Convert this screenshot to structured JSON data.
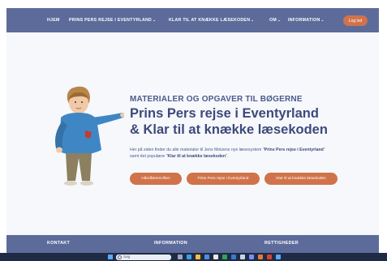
{
  "nav": {
    "items": [
      {
        "label": "HJEM",
        "dropdown": false
      },
      {
        "label": "PRINS PERS REJSE I EVENTYRLAND",
        "dropdown": true
      },
      {
        "label": "KLAR TIL AT KNÆKKE LÆSEKODEN",
        "dropdown": true
      },
      {
        "label": "OM",
        "dropdown": true
      },
      {
        "label": "INFORMATION",
        "dropdown": true
      }
    ],
    "login_label": "Log ind"
  },
  "hero": {
    "kicker": "MATERIALER OG OPGAVER TIL BØGERNE",
    "title_line1": "Prins Pers rejse i Eventyrland",
    "title_line2": "& Klar til at knække læsekoden",
    "intro_part1": "Her på siden finder du alle materialer til Jens Molzens nye læsesystem \"",
    "intro_bold1": "Prins Pers rejse i Eventyrland",
    "intro_part2": "\" samt det populære \"",
    "intro_bold2": "Klar til at knække læsekoden",
    "intro_part3": "\".",
    "buttons": [
      "Håndfærenviften",
      "Prins Pers rejse i Eventyrland",
      "Klar til at knække læsekoden"
    ]
  },
  "footer": {
    "headings": [
      "KONTAKT",
      "INFORMATION",
      "RETTIGHEDER"
    ]
  },
  "taskbar": {
    "search_placeholder": "Søg"
  },
  "colors": {
    "nav_bg": "#5c6b9a",
    "accent": "#d1734a",
    "heading": "#3c4a7a"
  }
}
